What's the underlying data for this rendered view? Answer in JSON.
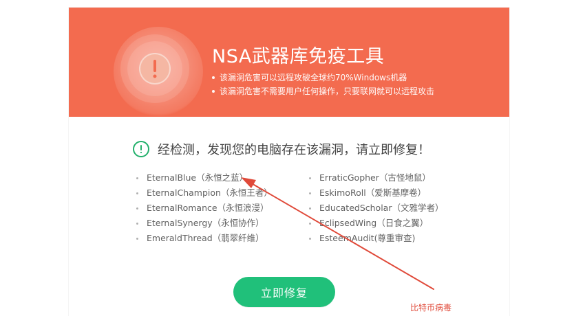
{
  "banner": {
    "title": "NSA武器库免疫工具",
    "bullets": [
      "该漏洞危害可以远程攻破全球约70%Windows机器",
      "该漏洞危害不需要用户任何操作，只要联网就可以远程攻击"
    ]
  },
  "status": {
    "message": "经检测，发现您的电脑存在该漏洞，请立即修复！"
  },
  "vulnerabilities": {
    "left": [
      "EternalBlue（永恒之蓝）",
      "EternalChampion（永恒王者）",
      "EternalRomance（永恒浪漫）",
      "EternalSynergy（永恒协作）",
      "EmeraldThread（翡翠纤维）"
    ],
    "right": [
      "ErraticGopher（古怪地鼠）",
      "EskimoRoll（爱斯基摩卷）",
      "EducatedScholar（文雅学者）",
      "EclipsedWing（日食之翼）",
      "EsteemAudit(尊重审查)"
    ]
  },
  "actions": {
    "fix_label": "立即修复"
  },
  "watermark": {
    "text": "比特币病毒"
  },
  "colors": {
    "banner_bg": "#f36b4f",
    "status_icon": "#22b06b",
    "button_bg": "#20c07a",
    "annotation": "#e04a3a"
  },
  "icons": {
    "banner_warning": "exclamation-circle-icon",
    "status": "exclamation-circle-icon",
    "annotation": "arrow-icon"
  }
}
